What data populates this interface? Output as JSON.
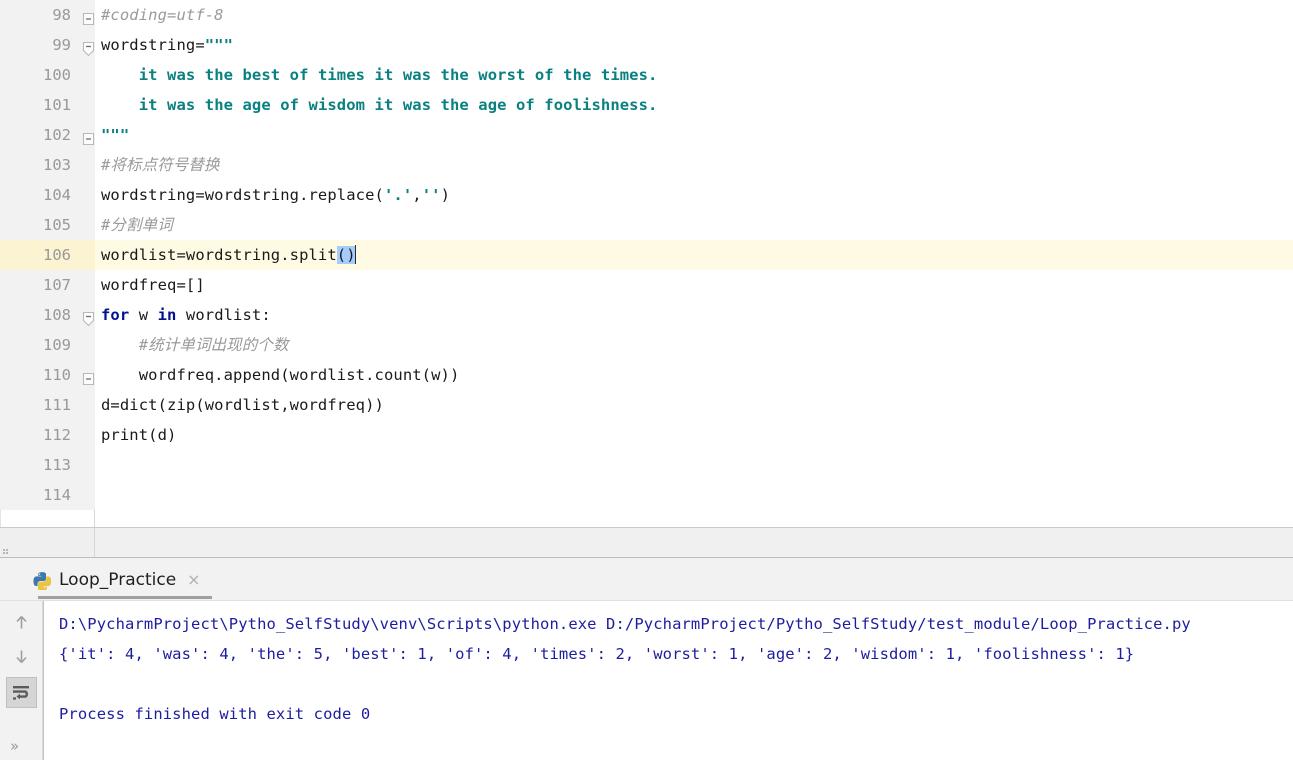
{
  "editor": {
    "first_line_number": 98,
    "current_line_number": 106,
    "selection_text": "()",
    "lines": [
      {
        "no": "98",
        "indent": 0,
        "fold": "end",
        "type": "comment",
        "text": "#coding=utf-8"
      },
      {
        "no": "99",
        "indent": 0,
        "fold": "start",
        "type": "code",
        "text": "wordstring=\"\"\""
      },
      {
        "no": "100",
        "indent": 1,
        "fold": "none",
        "type": "string",
        "text": "it was the best of times it was the worst of the times."
      },
      {
        "no": "101",
        "indent": 1,
        "fold": "none",
        "type": "string",
        "text": "it was the age of wisdom it was the age of foolishness."
      },
      {
        "no": "102",
        "indent": 0,
        "fold": "end",
        "type": "string",
        "text": "\"\"\""
      },
      {
        "no": "103",
        "indent": 0,
        "fold": "none",
        "type": "comment",
        "text": "#将标点符号替换"
      },
      {
        "no": "104",
        "indent": 0,
        "fold": "none",
        "type": "code",
        "text": "wordstring=wordstring.replace('.','')"
      },
      {
        "no": "105",
        "indent": 0,
        "fold": "none",
        "type": "comment",
        "text": "#分割单词"
      },
      {
        "no": "106",
        "indent": 0,
        "fold": "none",
        "type": "code",
        "text": "wordlist=wordstring.split()"
      },
      {
        "no": "107",
        "indent": 0,
        "fold": "none",
        "type": "code",
        "text": "wordfreq=[]"
      },
      {
        "no": "108",
        "indent": 0,
        "fold": "start",
        "type": "code",
        "text": "for w in wordlist:"
      },
      {
        "no": "109",
        "indent": 1,
        "fold": "none",
        "type": "comment",
        "text": "#统计单词出现的个数"
      },
      {
        "no": "110",
        "indent": 1,
        "fold": "end",
        "type": "code",
        "text": "wordfreq.append(wordlist.count(w))"
      },
      {
        "no": "111",
        "indent": 0,
        "fold": "none",
        "type": "code",
        "text": "d=dict(zip(wordlist,wordfreq))"
      },
      {
        "no": "112",
        "indent": 0,
        "fold": "none",
        "type": "code",
        "text": "print(d)"
      },
      {
        "no": "113",
        "indent": 0,
        "fold": "none",
        "type": "code",
        "text": ""
      },
      {
        "no": "114",
        "indent": 0,
        "fold": "none",
        "type": "code",
        "text": ""
      }
    ]
  },
  "console": {
    "panel_label": ":",
    "tab": {
      "title": "Loop_Practice",
      "icon": "python-icon",
      "close_label": "×"
    },
    "toolbar": {
      "up_label": "↑",
      "down_label": "↓",
      "soft_wrap_label": "soft-wrap-icon",
      "more_label": "»"
    },
    "output_lines": [
      "D:\\PycharmProject\\Pytho_SelfStudy\\venv\\Scripts\\python.exe D:/PycharmProject/Pytho_SelfStudy/test_module/Loop_Practice.py",
      "{'it': 4, 'was': 4, 'the': 5, 'best': 1, 'of': 4, 'times': 2, 'worst': 1, 'age': 2, 'wisdom': 1, 'foolishness': 1}",
      "",
      "Process finished with exit code 0"
    ]
  },
  "colors": {
    "current_line": "#fffae3",
    "selection": "#a5cdfb",
    "string": "#0a8080",
    "keyword": "#00128c",
    "comment": "#9a9a9a",
    "console_text": "#1d1da0",
    "gutter_bg": "#f2f2f2",
    "gutter_text": "#999999"
  }
}
